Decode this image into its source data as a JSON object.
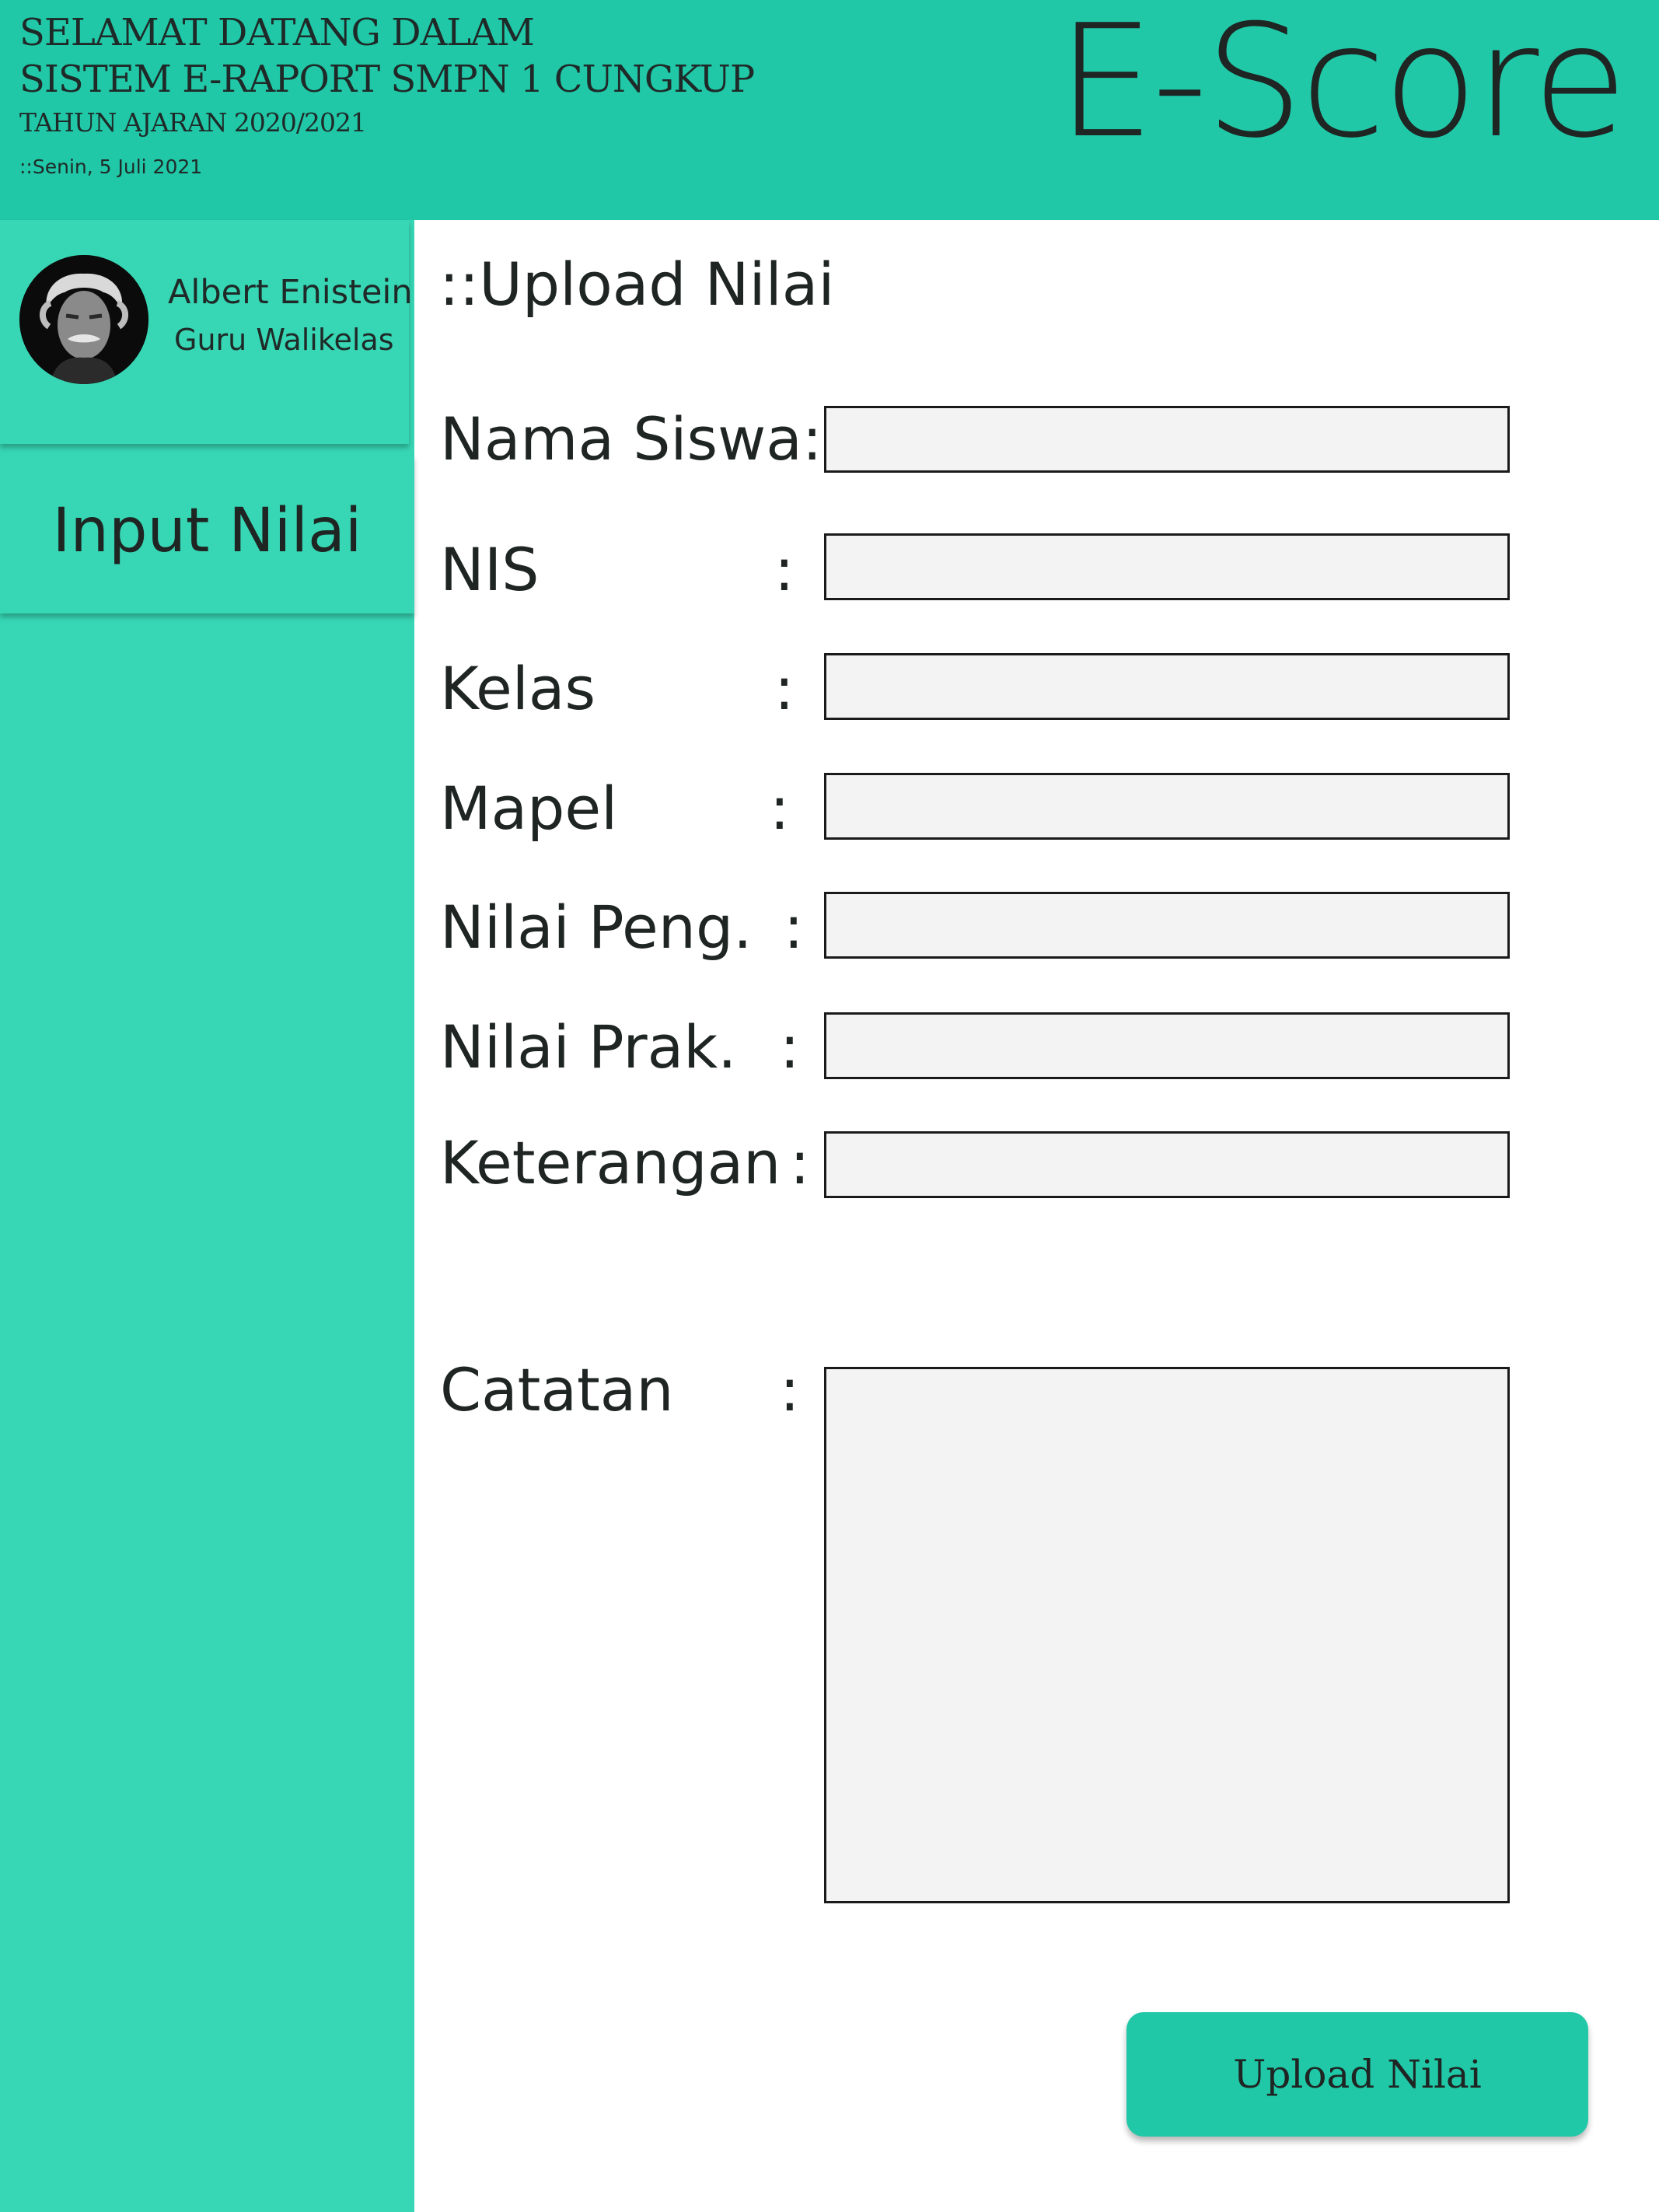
{
  "header": {
    "line1": "SELAMAT DATANG DALAM",
    "line2": "SISTEM E-RAPORT SMPN 1 CUNGKUP",
    "line3": "TAHUN AJARAN 2020/2021",
    "date": "::Senin, 5 Juli 2021",
    "brand": "E-Score"
  },
  "profile": {
    "name": "Albert Enistein",
    "role": "Guru Walikelas",
    "avatar_icon": "person-portrait-icon"
  },
  "sidebar": {
    "items": [
      {
        "label": "Input Nilai"
      }
    ]
  },
  "main": {
    "title": "::Upload Nilai",
    "fields": [
      {
        "label": "Nama Siswa:",
        "colon": "",
        "value": ""
      },
      {
        "label": "NIS",
        "colon": ":",
        "value": ""
      },
      {
        "label": "Kelas",
        "colon": ":",
        "value": ""
      },
      {
        "label": "Mapel",
        "colon": ":",
        "value": ""
      },
      {
        "label": "Nilai Peng.",
        "colon": ":",
        "value": ""
      },
      {
        "label": "Nilai Prak.",
        "colon": ":",
        "value": ""
      },
      {
        "label": "Keterangan",
        "colon": ":",
        "value": ""
      }
    ],
    "notes": {
      "label": "Catatan",
      "colon": ":",
      "value": ""
    },
    "submit_label": "Upload Nilai"
  },
  "colors": {
    "header_bg": "#20c8a8",
    "sidebar_bg": "#37d6b4",
    "button_bg": "#20c8a8",
    "field_bg": "#f3f3f3"
  }
}
